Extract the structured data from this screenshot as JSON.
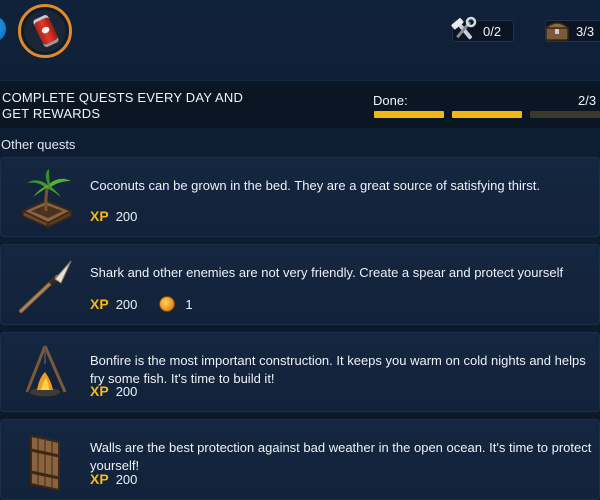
{
  "top": {
    "tools_counter": "0/2",
    "chest_counter": "3/3"
  },
  "daily": {
    "title": "COMPLETE QUESTS EVERY DAY AND GET REWARDS",
    "done_label": "Done:",
    "done_count": "2/3",
    "progress_completed": 2,
    "progress_total": 3
  },
  "section_title": "Other quests",
  "quests": [
    {
      "icon": "palm-planter-icon",
      "text": "Coconuts can be grown in the bed. They are a great source of satisfying thirst.",
      "xp_label": "XP",
      "xp": "200"
    },
    {
      "icon": "spear-icon",
      "text": "Shark and other enemies are not very friendly. Create a spear and protect yourself",
      "xp_label": "XP",
      "xp": "200",
      "coins": "1"
    },
    {
      "icon": "bonfire-icon",
      "text": "Bonfire is the most important construction. It keeps you warm on cold nights and helps fry some fish. It's time to build it!",
      "xp_label": "XP",
      "xp": "200"
    },
    {
      "icon": "wooden-wall-icon",
      "text": "Walls are the best protection against bad weather in the open ocean. It's time to protect yourself!",
      "xp_label": "XP",
      "xp": "200"
    }
  ],
  "colors": {
    "accent": "#f2b615",
    "xp": "#f5b81c",
    "avatar_ring": "#e08a28",
    "background": "#0d1c30"
  }
}
